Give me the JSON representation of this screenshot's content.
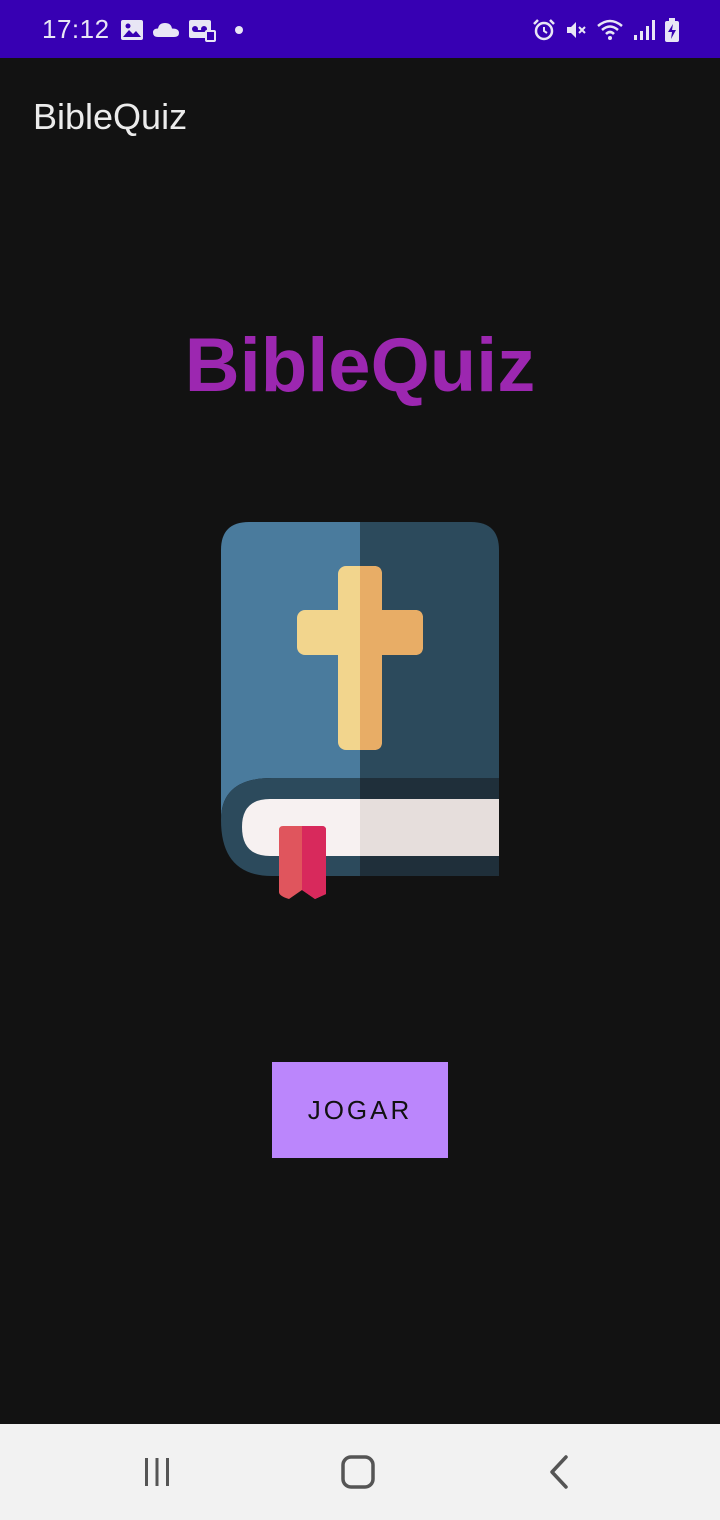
{
  "status_bar": {
    "time": "17:12",
    "left_icons": [
      "image-icon",
      "cloud-icon",
      "voicemail-icon",
      "dot-icon"
    ],
    "right_icons": [
      "alarm-icon",
      "mute-icon",
      "wifi-icon",
      "signal-icon",
      "battery-icon"
    ],
    "background": "#3700b3"
  },
  "toolbar": {
    "title": "BibleQuiz"
  },
  "main": {
    "headline": "BibleQuiz",
    "headline_color": "#9c27b0",
    "logo": "bible-book-icon",
    "play_button_label": "JOGAR",
    "play_button_color": "#bb86fc"
  },
  "nav_bar": {
    "buttons": [
      "recent-apps-icon",
      "home-icon",
      "back-icon"
    ]
  }
}
